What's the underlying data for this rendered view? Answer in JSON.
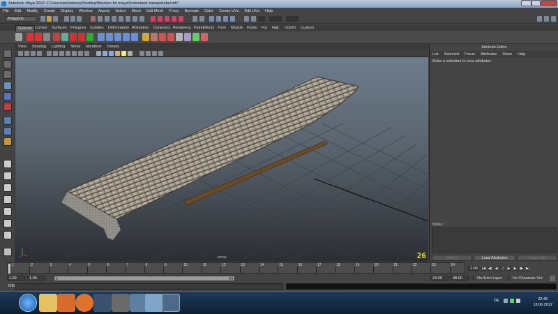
{
  "window": {
    "title": "Autodesk Maya 2012: C:\\Users\\tackleberry\\Desktop\\Brücken für maya\\Unterstand transportabel.mb*"
  },
  "menubar": [
    "File",
    "Edit",
    "Modify",
    "Create",
    "Display",
    "Window",
    "Assets",
    "Select",
    "Mesh",
    "Edit Mesh",
    "Proxy",
    "Normals",
    "Color",
    "Create UVs",
    "Edit UVs",
    "Help"
  ],
  "statusline": {
    "mode": "Polygons"
  },
  "shelf_tabs": [
    "General",
    "Curves",
    "Surfaces",
    "Polygons",
    "Subdivs",
    "Deformation",
    "Animation",
    "Dynamics",
    "Rendering",
    "PaintEffects",
    "Toon",
    "Muscle",
    "Fluids",
    "Fur",
    "Hair",
    "nCloth",
    "Custom"
  ],
  "shelf_active": "General",
  "panel_menu": [
    "View",
    "Shading",
    "Lighting",
    "Show",
    "Renderer",
    "Panels"
  ],
  "viewport": {
    "camera": "persp",
    "frame_counter": "26"
  },
  "attribute_editor": {
    "header": "Attribute Editor",
    "menu": [
      "List",
      "Selected",
      "Focus",
      "Attributes",
      "Show",
      "Help"
    ],
    "message": "Make a selection to view attributes",
    "notes_label": "Notes:",
    "buttons": {
      "select": "Select",
      "load": "Load Attributes",
      "copy": "Copy Tab"
    }
  },
  "timeslider": {
    "labels": [
      "1",
      "2",
      "3",
      "4",
      "5",
      "6",
      "7",
      "8",
      "9",
      "10",
      "11",
      "12",
      "13",
      "14",
      "15",
      "16",
      "17",
      "18",
      "19",
      "20",
      "21",
      "22",
      "23",
      "24"
    ],
    "current_frame": "1.00"
  },
  "rangebar": {
    "start": "1.00",
    "playback_start": "1.00",
    "range_start": "1",
    "range_end": "24",
    "end_a": "24.00",
    "end_b": "48.00",
    "anim_layer": "No Anim Layer",
    "char_set": "No Character Set"
  },
  "cmdline": {
    "label": "MEL"
  },
  "taskbar": {
    "lang": "DE",
    "time": "22:49",
    "date": "13.06.2012"
  }
}
